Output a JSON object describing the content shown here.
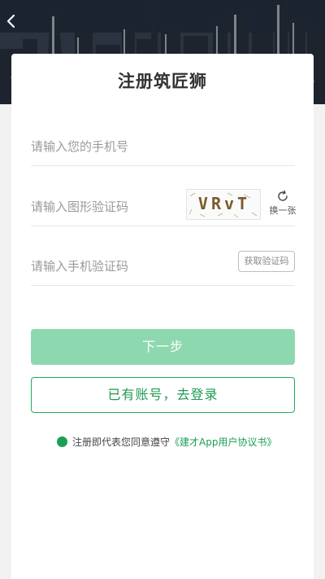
{
  "header": {
    "back_icon": "chevron-left-icon"
  },
  "page": {
    "title": "注册筑匠狮"
  },
  "form": {
    "phone_placeholder": "请输入您的手机号",
    "phone_value": "",
    "captcha_placeholder": "请输入图形验证码",
    "captcha_value": "",
    "captcha_image_text": "VRvT",
    "refresh_icon": "refresh-icon",
    "refresh_label": "换一张",
    "sms_placeholder": "请输入手机验证码",
    "sms_value": "",
    "sms_button_label": "获取验证码"
  },
  "actions": {
    "next_label": "下一步",
    "login_label": "已有账号，去登录"
  },
  "agreement": {
    "text": "注册即代表您同意遵守",
    "link": "《建才App用户协议书》",
    "checked": true
  },
  "colors": {
    "accent": "#1b9e55",
    "next_button": "#8ed8b0",
    "background": "#f2f2f2"
  }
}
